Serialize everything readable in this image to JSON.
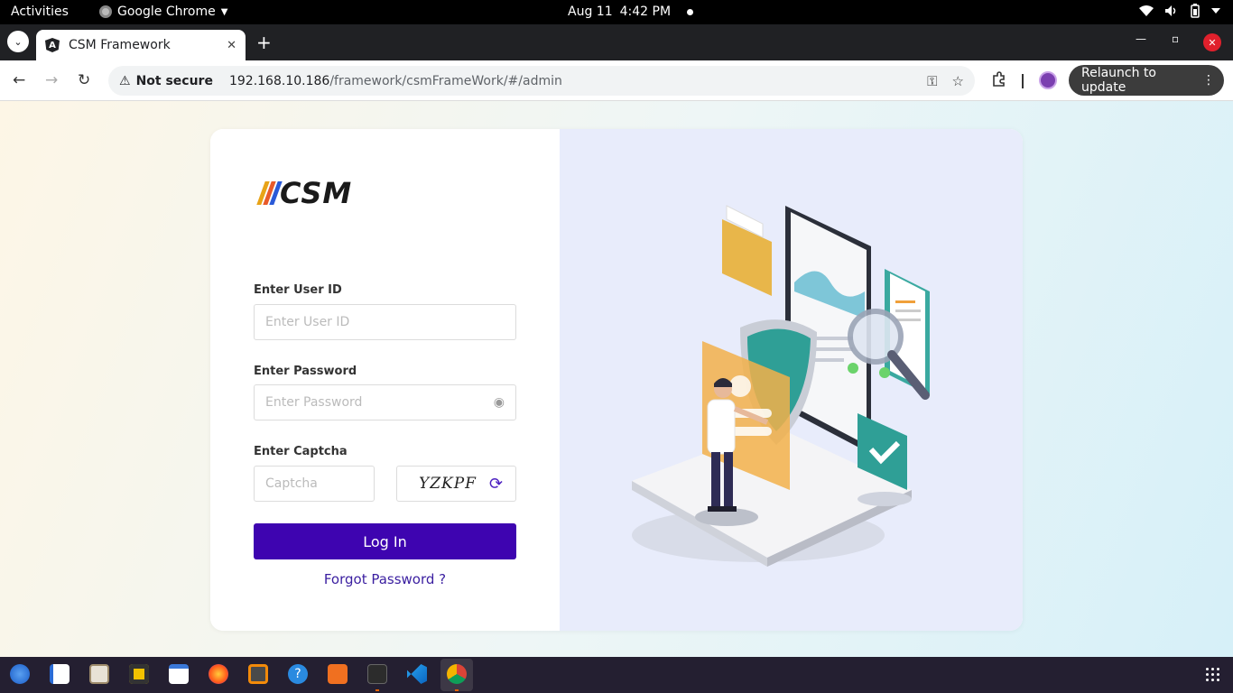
{
  "topbar": {
    "activities": "Activities",
    "app_name": "Google Chrome",
    "date": "Aug 11",
    "time": "4:42 PM"
  },
  "browser": {
    "tab_title": "CSM Framework",
    "security_label": "Not secure",
    "url_host": "192.168.10.186",
    "url_path": "/framework/csmFrameWork/#/admin",
    "relaunch_label": "Relaunch to update"
  },
  "page": {
    "logo_text": "CSM",
    "logo_stripe_colors": [
      "#e8a317",
      "#e85a2a",
      "#2a5ad8"
    ],
    "userid_label": "Enter User ID",
    "userid_placeholder": "Enter User ID",
    "password_label": "Enter Password",
    "password_placeholder": "Enter Password",
    "captcha_label": "Enter Captcha",
    "captcha_placeholder": "Captcha",
    "captcha_code": "YZKPF",
    "login_label": "Log In",
    "forgot_label": "Forgot Password ?",
    "accent_color": "#3e04b0"
  },
  "dock": {
    "apps": [
      "thunderbird",
      "libreoffice-writer",
      "files",
      "rhythmbox",
      "text-editor",
      "firefox",
      "sublime-text",
      "help",
      "software-center",
      "terminal",
      "vscode",
      "chrome"
    ]
  }
}
